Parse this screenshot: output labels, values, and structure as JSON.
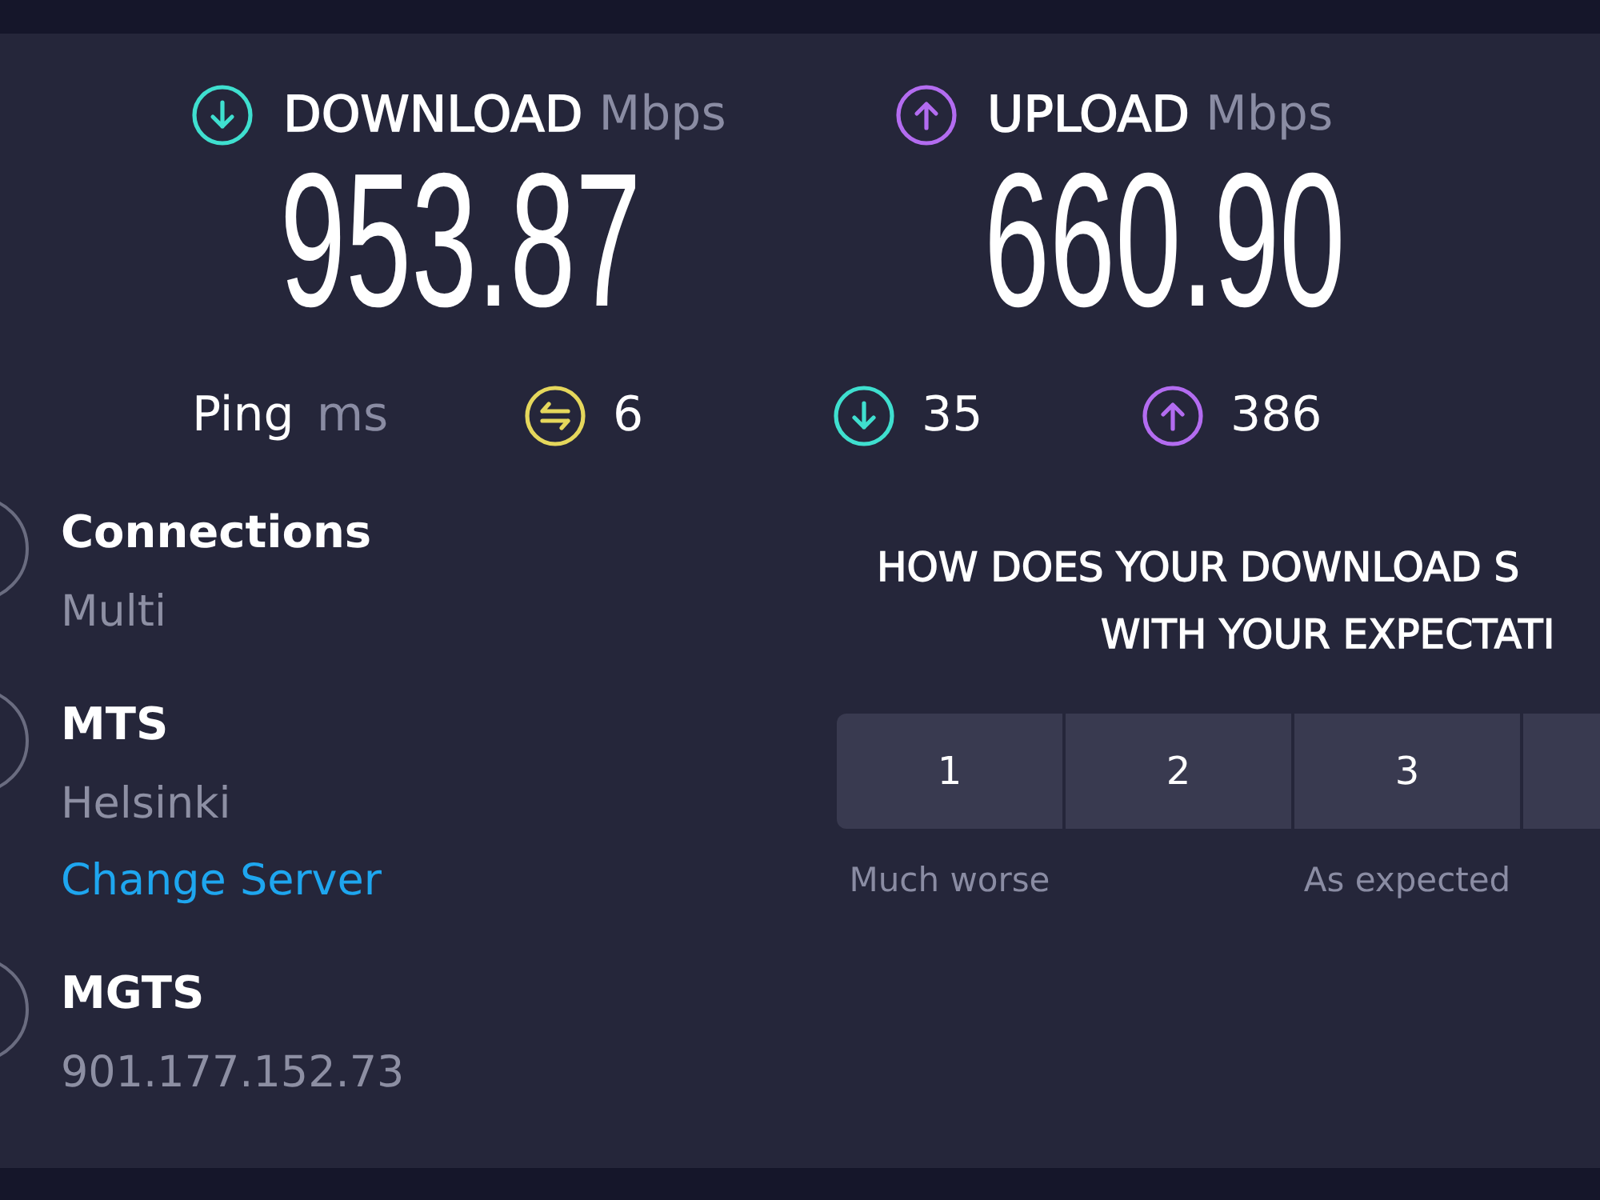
{
  "speeds": [
    {
      "kind": "download",
      "label": "DOWNLOAD",
      "unit": "Mbps",
      "value": "953.87"
    },
    {
      "kind": "upload",
      "label": "UPLOAD",
      "unit": "Mbps",
      "value": "660.90"
    }
  ],
  "ping": {
    "label": "Ping",
    "unit": "ms",
    "readings": [
      {
        "kind": "idle",
        "value": "6"
      },
      {
        "kind": "download",
        "value": "35"
      },
      {
        "kind": "upload",
        "value": "386"
      }
    ]
  },
  "details": [
    {
      "title": "Connections",
      "lines": [
        {
          "kind": "text",
          "text": "Multi"
        }
      ]
    },
    {
      "title": "MTS",
      "lines": [
        {
          "kind": "text",
          "text": "Helsinki"
        },
        {
          "kind": "link",
          "text": "Change Server"
        }
      ]
    },
    {
      "title": "MGTS",
      "lines": [
        {
          "kind": "text",
          "text": "901.177.152.73"
        }
      ]
    }
  ],
  "survey": {
    "question_lines": [
      "HOW DOES YOUR DOWNLOAD S",
      "WITH YOUR EXPECTATI"
    ],
    "options": [
      {
        "label": "1",
        "selected": false,
        "caption": "Much worse"
      },
      {
        "label": "2",
        "selected": false
      },
      {
        "label": "3",
        "selected": false,
        "caption": "As expected"
      }
    ],
    "clipped_option": true
  }
}
